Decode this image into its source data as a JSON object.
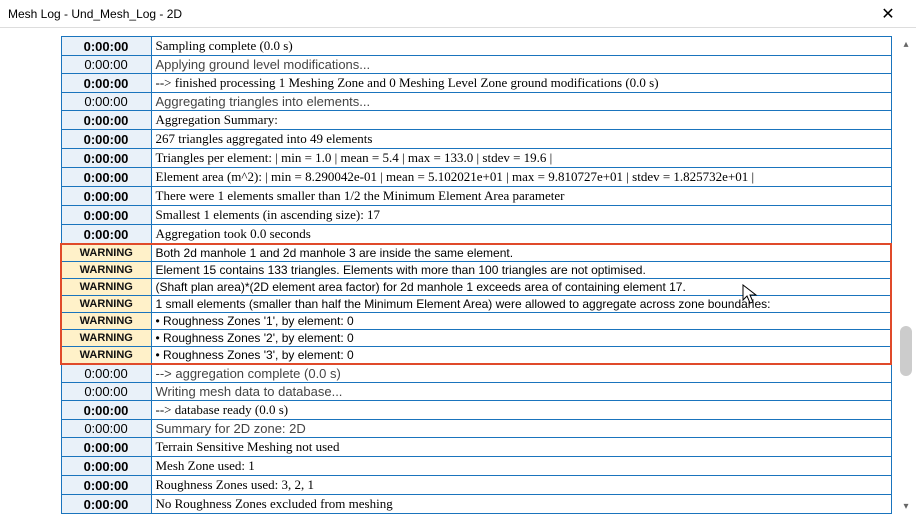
{
  "window": {
    "title": "Mesh Log - Und_Mesh_Log - 2D",
    "close_label": "✕"
  },
  "scrollbar": {
    "up": "▴",
    "down": "▾"
  },
  "rows": [
    {
      "time": "0:00:00",
      "timeClass": "ts-bg ts-bold",
      "msg": "Sampling complete (0.0 s)",
      "msgClass": "msg-serif",
      "warn": false
    },
    {
      "time": "0:00:00",
      "timeClass": "ts-bg",
      "msg": "Applying ground level modifications...",
      "msgClass": "msg-sans",
      "warn": false
    },
    {
      "time": "0:00:00",
      "timeClass": "ts-bg ts-bold",
      "msg": "--> finished processing 1 Meshing Zone and 0 Meshing Level Zone ground modifications (0.0 s)",
      "msgClass": "msg-serif",
      "warn": false
    },
    {
      "time": "0:00:00",
      "timeClass": "ts-bg",
      "msg": "Aggregating triangles into elements...",
      "msgClass": "msg-sans",
      "warn": false
    },
    {
      "time": "0:00:00",
      "timeClass": "ts-bg ts-bold",
      "msg": "Aggregation Summary:",
      "msgClass": "msg-serif",
      "warn": false
    },
    {
      "time": "0:00:00",
      "timeClass": "ts-bg ts-bold",
      "msg": "267 triangles aggregated into 49 elements",
      "msgClass": "msg-serif",
      "warn": false
    },
    {
      "time": "0:00:00",
      "timeClass": "ts-bg ts-bold",
      "msg": "Triangles per element: | min = 1.0 | mean = 5.4 | max = 133.0 | stdev = 19.6 |",
      "msgClass": "msg-serif",
      "warn": false
    },
    {
      "time": "0:00:00",
      "timeClass": "ts-bg ts-bold",
      "msg": "Element area (m^2): | min = 8.290042e-01 | mean = 5.102021e+01 | max = 9.810727e+01 | stdev = 1.825732e+01 |",
      "msgClass": "msg-serif",
      "warn": false
    },
    {
      "time": "0:00:00",
      "timeClass": "ts-bg ts-bold",
      "msg": "There were 1 elements smaller than 1/2 the Minimum Element Area parameter",
      "msgClass": "msg-serif",
      "warn": false
    },
    {
      "time": "0:00:00",
      "timeClass": "ts-bg ts-bold",
      "msg": "Smallest 1 elements (in ascending size): 17",
      "msgClass": "msg-serif",
      "warn": false
    },
    {
      "time": "0:00:00",
      "timeClass": "ts-bg ts-bold",
      "msg": "Aggregation took 0.0 seconds",
      "msgClass": "msg-serif",
      "warn": false
    },
    {
      "time": "WARNING",
      "timeClass": "",
      "msg": "Both 2d manhole 1 and 2d manhole 3 are inside the same element.",
      "msgClass": "",
      "warn": true
    },
    {
      "time": "WARNING",
      "timeClass": "",
      "msg": "Element 15 contains 133 triangles. Elements with more than 100 triangles are not optimised.",
      "msgClass": "",
      "warn": true
    },
    {
      "time": "WARNING",
      "timeClass": "",
      "msg": "(Shaft plan area)*(2D element area factor) for 2d manhole 1 exceeds area of containing element 17.",
      "msgClass": "",
      "warn": true
    },
    {
      "time": "WARNING",
      "timeClass": "",
      "msg": "1 small elements (smaller than half the Minimum Element Area) were allowed to aggregate across zone boundaries:",
      "msgClass": "",
      "warn": true
    },
    {
      "time": "WARNING",
      "timeClass": "",
      "msg": "     • Roughness Zones '1', by element: 0",
      "msgClass": "",
      "warn": true
    },
    {
      "time": "WARNING",
      "timeClass": "",
      "msg": "     • Roughness Zones '2', by element: 0",
      "msgClass": "",
      "warn": true
    },
    {
      "time": "WARNING",
      "timeClass": "",
      "msg": "     • Roughness Zones '3', by element: 0",
      "msgClass": "",
      "warn": true
    },
    {
      "time": "0:00:00",
      "timeClass": "ts-bg",
      "msg": "--> aggregation complete (0.0 s)",
      "msgClass": "msg-sans",
      "warn": false
    },
    {
      "time": "0:00:00",
      "timeClass": "ts-bg",
      "msg": "Writing mesh data to database...",
      "msgClass": "msg-sans",
      "warn": false
    },
    {
      "time": "0:00:00",
      "timeClass": "ts-bg ts-bold",
      "msg": "--> database ready (0.0 s)",
      "msgClass": "msg-serif",
      "warn": false
    },
    {
      "time": "0:00:00",
      "timeClass": "ts-bg",
      "msg": "Summary for 2D zone: 2D",
      "msgClass": "msg-sans",
      "warn": false
    },
    {
      "time": "0:00:00",
      "timeClass": "ts-bg ts-bold",
      "msg": "Terrain Sensitive Meshing not used",
      "msgClass": "msg-serif",
      "warn": false
    },
    {
      "time": "0:00:00",
      "timeClass": "ts-bg ts-bold",
      "msg": "Mesh Zone used: 1",
      "msgClass": "msg-serif",
      "warn": false
    },
    {
      "time": "0:00:00",
      "timeClass": "ts-bg ts-bold",
      "msg": "Roughness Zones used: 3, 2, 1",
      "msgClass": "msg-serif",
      "warn": false
    },
    {
      "time": "0:00:00",
      "timeClass": "ts-bg ts-bold",
      "msg": "No Roughness Zones excluded from meshing",
      "msgClass": "msg-serif",
      "warn": false
    }
  ]
}
